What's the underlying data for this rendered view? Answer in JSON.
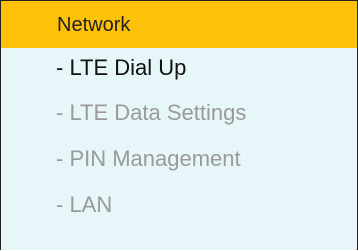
{
  "menu": {
    "header_label": "Network",
    "items": [
      {
        "label": "- LTE Dial Up",
        "state": "active"
      },
      {
        "label": "- LTE Data Settings",
        "state": "inactive"
      },
      {
        "label": "- PIN Management",
        "state": "inactive"
      },
      {
        "label": "- LAN",
        "state": "inactive"
      }
    ]
  },
  "colors": {
    "header_bg": "#fdc10a",
    "menu_bg": "#e6f6f9",
    "active_text": "#111111",
    "inactive_text": "#9a9a9a"
  }
}
